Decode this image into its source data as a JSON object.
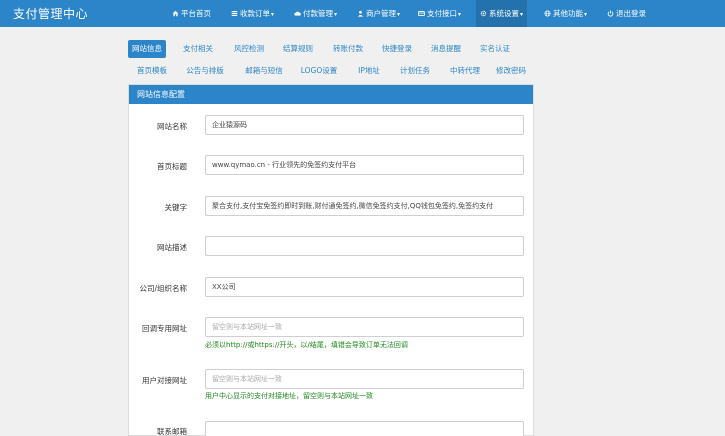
{
  "brand": "支付管理中心",
  "nav": [
    {
      "label": "平台首页",
      "icon": "home-icon",
      "caret": false
    },
    {
      "label": "收款订单",
      "icon": "list-icon",
      "caret": true
    },
    {
      "label": "付款管理",
      "icon": "cloud-icon",
      "caret": true
    },
    {
      "label": "商户管理",
      "icon": "user-icon",
      "caret": true
    },
    {
      "label": "支付接口",
      "icon": "card-icon",
      "caret": true
    },
    {
      "label": "系统设置",
      "icon": "gear-icon",
      "caret": true
    },
    {
      "label": "其他功能",
      "icon": "globe-icon",
      "caret": true
    },
    {
      "label": "退出登录",
      "icon": "power-icon",
      "caret": false
    }
  ],
  "tabs_row1": [
    "网站信息",
    "支付相关",
    "风控检测",
    "结算规则",
    "转账付款",
    "快捷登录",
    "消息提醒",
    "实名认证"
  ],
  "tabs_row2": [
    "首页模板",
    "公告与排版",
    "邮箱与短信",
    "LOGO设置",
    "IP地址",
    "计划任务",
    "中转代理",
    "修改密码"
  ],
  "active_tab": "网站信息",
  "panel_title": "网站信息配置",
  "fields": [
    {
      "label": "网站名称",
      "value": "企业猿源码",
      "placeholder": "",
      "help": ""
    },
    {
      "label": "首页标题",
      "value": "www.qymao.cn - 行业领先的免签约支付平台",
      "placeholder": "",
      "help": ""
    },
    {
      "label": "关键字",
      "value": "聚合支付,支付宝免签约即时到账,财付通免签约,微信免签约支付,QQ钱包免签约,免签约支付",
      "placeholder": "",
      "help": ""
    },
    {
      "label": "网站描述",
      "value": "",
      "placeholder": "",
      "help": ""
    },
    {
      "label": "公司/组织名称",
      "value": "XX公司",
      "placeholder": "",
      "help": ""
    },
    {
      "label": "回调专用网址",
      "value": "",
      "placeholder": "留空则与本站网址一致",
      "help": "必须以http://或https://开头，以/结尾，填错会导致订单无法回调"
    },
    {
      "label": "用户对接网址",
      "value": "",
      "placeholder": "留空则与本站网址一致",
      "help": "用户中心显示的支付对接地址，留空则与本站网址一致"
    },
    {
      "label": "联系邮箱",
      "value": "",
      "placeholder": "",
      "help": ""
    }
  ],
  "colors": {
    "primary": "#2c85c8",
    "help_text": "#1f8a1f"
  }
}
